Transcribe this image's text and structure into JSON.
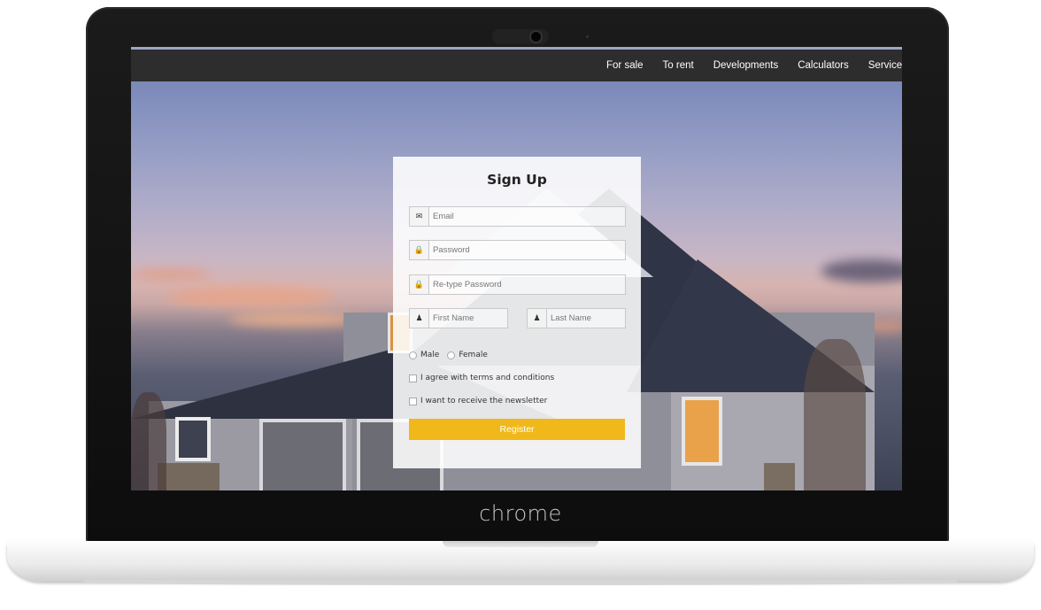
{
  "device": {
    "brand_text": "chrome"
  },
  "nav": {
    "items": [
      "For sale",
      "To rent",
      "Developments",
      "Calculators",
      "Services("
    ]
  },
  "signup": {
    "title": "Sign Up",
    "email_placeholder": "Email",
    "password_placeholder": "Password",
    "retype_placeholder": "Re-type Password",
    "first_name_placeholder": "First Name",
    "last_name_placeholder": "Last Name",
    "gender_male": "Male",
    "gender_female": "Female",
    "terms_label": "I agree with terms and conditions",
    "newsletter_label": "I want to receive the newsletter",
    "register_label": "Register"
  },
  "colors": {
    "nav_bg": "#2d2d2d",
    "accent": "#f0b81a",
    "card_bg": "rgba(255,255,255,0.88)"
  },
  "icons": {
    "email": "envelope-icon",
    "password": "lock-icon",
    "name": "user-icon"
  }
}
